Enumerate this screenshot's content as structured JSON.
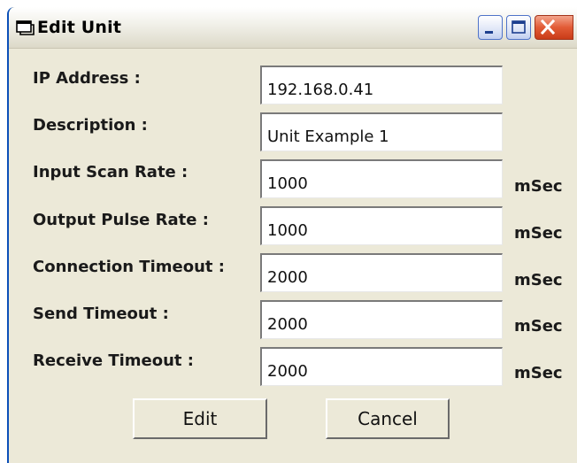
{
  "window": {
    "title": "Edit Unit",
    "icon": "window-app-icon",
    "controls": [
      "minimize-icon",
      "maximize-icon",
      "close-icon"
    ]
  },
  "form": {
    "ip_address": {
      "label": "IP Address :",
      "value": "192.168.0.41"
    },
    "description": {
      "label": "Description :",
      "value": "Unit Example 1"
    },
    "input_scan_rate": {
      "label": "Input Scan Rate :",
      "value": "1000",
      "unit": "mSec"
    },
    "output_pulse_rate": {
      "label": "Output Pulse Rate :",
      "value": "1000",
      "unit": "mSec"
    },
    "connection_timeout": {
      "label": "Connection Timeout :",
      "value": "2000",
      "unit": "mSec"
    },
    "send_timeout": {
      "label": "Send Timeout :",
      "value": "2000",
      "unit": "mSec"
    },
    "receive_timeout": {
      "label": "Receive Timeout :",
      "value": "2000",
      "unit": "mSec"
    }
  },
  "buttons": {
    "edit": "Edit",
    "cancel": "Cancel"
  },
  "colors": {
    "dialog_bg": "#ece9d8",
    "titlebar_blue": "#0b4fb8",
    "close_red": "#e25b36"
  }
}
